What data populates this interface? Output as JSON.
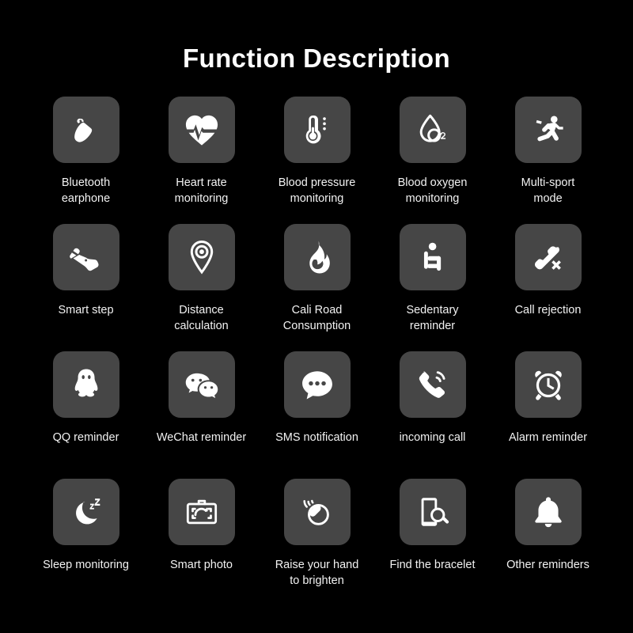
{
  "page": {
    "title": "Function Description",
    "background_color": "#000000",
    "tile_color": "#464646",
    "icon_color": "#ffffff",
    "text_color": "#f2f2f2"
  },
  "grid": {
    "columns": 5,
    "rows": 4,
    "items": [
      {
        "icon": "bluetooth-earphone-icon",
        "label": "Bluetooth\nearphone"
      },
      {
        "icon": "heart-rate-icon",
        "label": "Heart rate\nmonitoring"
      },
      {
        "icon": "thermometer-icon",
        "label": "Blood pressure\nmonitoring"
      },
      {
        "icon": "blood-oxygen-icon",
        "label": "Blood oxygen\nmonitoring"
      },
      {
        "icon": "running-person-icon",
        "label": "Multi-sport\nmode"
      },
      {
        "icon": "shoe-icon",
        "label": "Smart step"
      },
      {
        "icon": "location-pin-icon",
        "label": "Distance\ncalculation"
      },
      {
        "icon": "flame-icon",
        "label": "Cali Road\nConsumption"
      },
      {
        "icon": "sitting-person-icon",
        "label": "Sedentary\nreminder"
      },
      {
        "icon": "call-reject-icon",
        "label": "Call rejection"
      },
      {
        "icon": "qq-penguin-icon",
        "label": "QQ reminder"
      },
      {
        "icon": "wechat-icon",
        "label": "WeChat reminder"
      },
      {
        "icon": "sms-bubble-icon",
        "label": "SMS notification"
      },
      {
        "icon": "incoming-call-icon",
        "label": "incoming call"
      },
      {
        "icon": "alarm-clock-icon",
        "label": "Alarm reminder"
      },
      {
        "icon": "moon-sleep-icon",
        "label": "Sleep monitoring"
      },
      {
        "icon": "camera-icon",
        "label": "Smart photo"
      },
      {
        "icon": "raise-wrist-icon",
        "label": "Raise your hand\nto brighten"
      },
      {
        "icon": "find-bracelet-icon",
        "label": "Find the bracelet"
      },
      {
        "icon": "bell-icon",
        "label": "Other reminders"
      }
    ]
  }
}
